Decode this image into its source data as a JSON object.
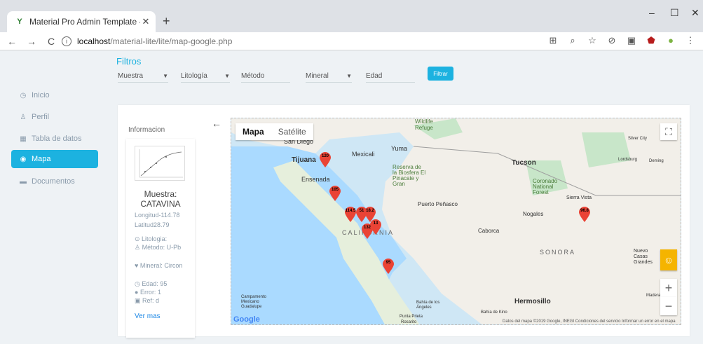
{
  "browser": {
    "tab_title": "Material Pro Admin Template - T",
    "tab_close": "✕",
    "new_tab": "+",
    "url_host": "localhost",
    "url_path": "/material-lite/lite/map-google.php",
    "win_min": "–",
    "win_max": "☐",
    "win_close": "✕"
  },
  "sidebar": {
    "items": [
      {
        "label": "Inicio",
        "icon": "home-icon"
      },
      {
        "label": "Perfil",
        "icon": "user-icon"
      },
      {
        "label": "Tabla de datos",
        "icon": "table-icon"
      },
      {
        "label": "Mapa",
        "icon": "globe-icon"
      },
      {
        "label": "Documentos",
        "icon": "folder-icon"
      }
    ],
    "active_color": "#1cb2e0"
  },
  "filters": {
    "title": "Filtros",
    "muestra": "Muestra",
    "litologia": "Litología",
    "metodo": "Método",
    "mineral": "Mineral",
    "edad": "Edad",
    "button": "Filtrar"
  },
  "info": {
    "title": "Informacion",
    "muestra": "Muestra: CATAVINA",
    "longitud_label": "Longitud",
    "longitud_value": "-114.78",
    "latitud_label": "Latitud",
    "latitud_value": "28.79",
    "litologia": "Litologia:",
    "metodo": "Método: U-Pb",
    "mineral": "Mineral: Circon",
    "edad": "Edad: 95",
    "error": "Error: 1",
    "ref": "Ref: d",
    "ver_mas": "Ver mas"
  },
  "map": {
    "tab_map": "Mapa",
    "tab_satellite": "Satélite",
    "zoom_in": "+",
    "zoom_out": "−",
    "fullscreen": "⛶",
    "labels": {
      "san_diego": "San Diego",
      "tijuana": "Tijuana",
      "mexicali": "Mexicali",
      "yuma": "Yuma",
      "tucson": "Tucson",
      "ensenada": "Ensenada",
      "reserva": "Reserva de la Biosfera El Pinacate y Gran",
      "puerto_penasco": "Puerto Peñasco",
      "coronado": "Coronado National Forest",
      "sierra_vista": "Sierra Vista",
      "nogales": "Nogales",
      "caborca": "Caborca",
      "sonora": "SONORA",
      "california": "CALIFORNIA",
      "hermosillo": "Hermosillo",
      "nuevo_casas": "Nuevo Casas Grandes",
      "wildlife": "Wildlife Refuge",
      "silver_city": "Silver City",
      "lordsburg": "Lordsburg",
      "deming": "Deming",
      "madera": "Madera",
      "campamento": "Campamento Mexicano Guadalupe",
      "bahia": "Bahía de los Ángeles",
      "bahia_kino": "Bahía de Kino",
      "punta_prieta": "Punta Prieta",
      "rosarito": "Rosarito"
    },
    "markers": [
      "120",
      "105",
      "114.5",
      "51",
      "18.2",
      "13",
      "132",
      "95",
      "96.8"
    ],
    "footer": "Datos del mapa ©2019 Google, INEGI   Condiciones del servicio   Informar un error en el mapa",
    "google": "Google",
    "water_color": "#aadaff",
    "land_color": "#f2efe9",
    "marker_color": "#ea4335"
  }
}
